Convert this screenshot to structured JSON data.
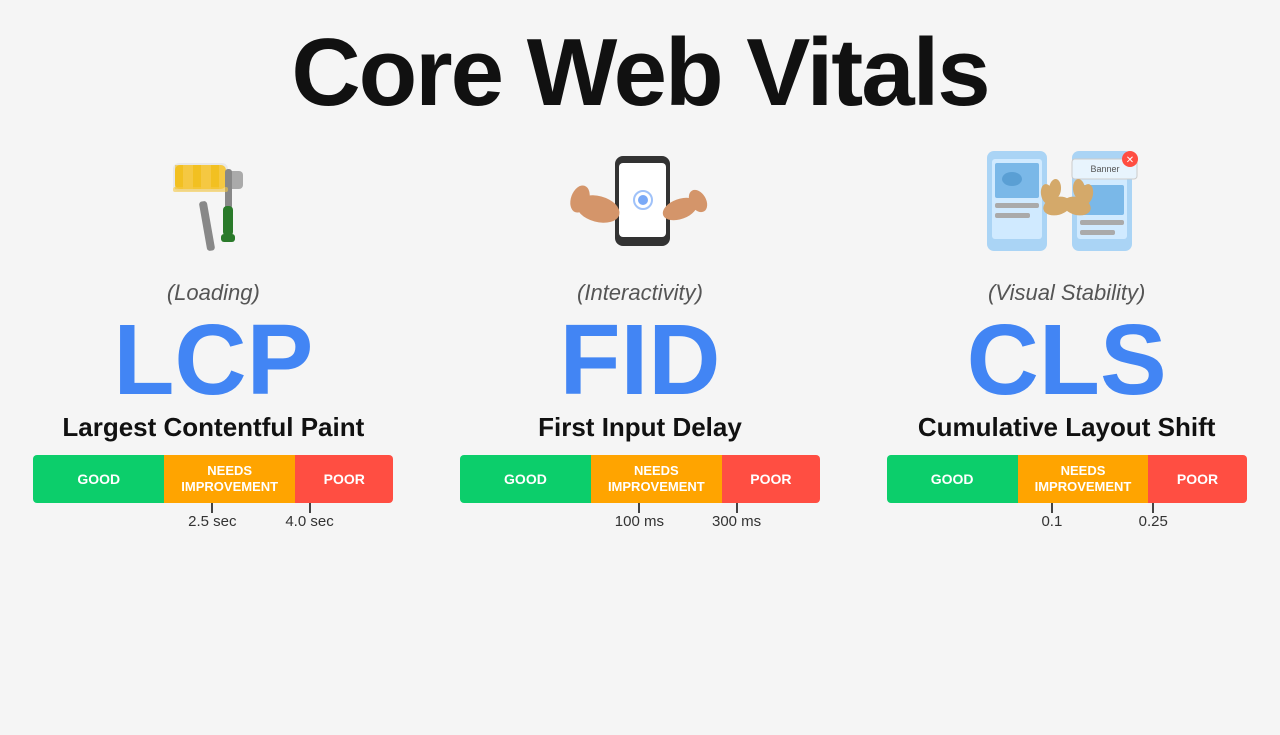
{
  "title": "Core Web Vitals",
  "metrics": [
    {
      "id": "lcp",
      "acronym": "LCP",
      "name": "Largest Contentful Paint",
      "caption": "(Loading)",
      "icon": "paint-roller",
      "bar": {
        "good_label": "GOOD",
        "needs_label": "NEEDS\nIMPROVEMENT",
        "poor_label": "POOR"
      },
      "threshold1": "2.5 sec",
      "threshold2": "4.0 sec",
      "tick1_pos": 44,
      "tick2_pos": 72
    },
    {
      "id": "fid",
      "acronym": "FID",
      "name": "First Input Delay",
      "caption": "(Interactivity)",
      "icon": "touch",
      "bar": {
        "good_label": "GOOD",
        "needs_label": "NEEDS\nIMPROVEMENT",
        "poor_label": "POOR"
      },
      "threshold1": "100 ms",
      "threshold2": "300 ms",
      "tick1_pos": 44,
      "tick2_pos": 72
    },
    {
      "id": "cls",
      "acronym": "CLS",
      "name": "Cumulative Layout Shift",
      "caption": "(Visual Stability)",
      "icon": "layout-shift",
      "bar": {
        "good_label": "GOOD",
        "needs_label": "NEEDS\nIMPROVEMENT",
        "poor_label": "POOR"
      },
      "threshold1": "0.1",
      "threshold2": "0.25",
      "tick1_pos": 44,
      "tick2_pos": 72
    }
  ],
  "colors": {
    "good": "#0cce6b",
    "needs": "#ffa400",
    "poor": "#ff4e42",
    "accent": "#4285f4"
  }
}
